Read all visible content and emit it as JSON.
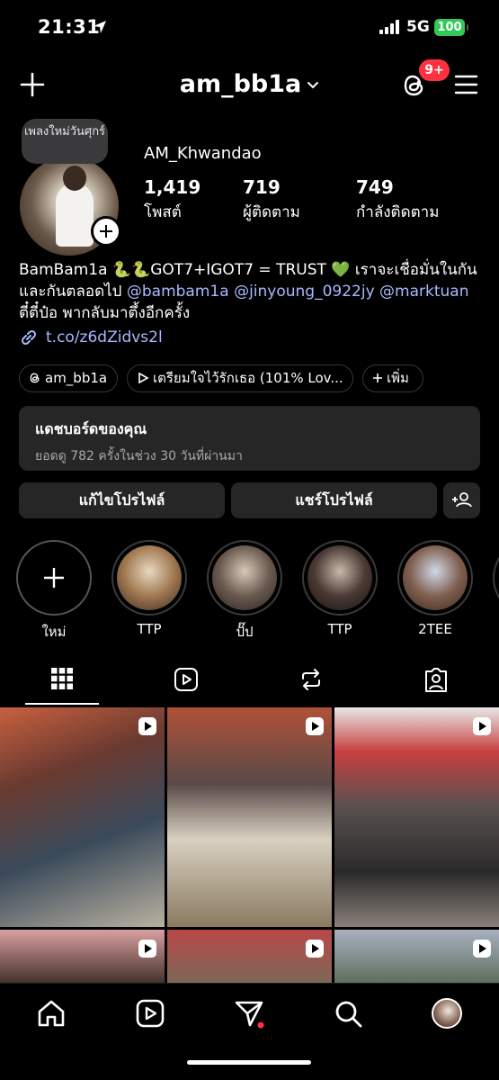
{
  "status_bar": {
    "time": "21:31",
    "network": "5G",
    "battery": "100"
  },
  "header": {
    "username": "am_bb1a",
    "notification_count": "9+"
  },
  "profile": {
    "note": "เพลงใหม่วันศุกร์",
    "display_name": "AM_Khwandao",
    "stats": [
      {
        "num": "1,419",
        "label": "โพสต์"
      },
      {
        "num": "719",
        "label": "ผู้ติดตาม"
      },
      {
        "num": "749",
        "label": "กำลังติดตาม"
      }
    ]
  },
  "bio": {
    "line1": "BamBam1a 🐍🐍GOT7+IGOT7 = TRUST 💚 เราจะเชื่อมั่นในกัน",
    "line2_text": "และกันตลอดไป ",
    "mentions": [
      "@bambam1a",
      "@jinyoung_0922jy",
      "@marktuan"
    ],
    "line3": "ตี๋ตี๋ป๋อ พากลับมาตึ้งอีกครั้ง",
    "link": "t.co/z6dZidvs2l"
  },
  "chips": [
    {
      "label": "am_bb1a"
    },
    {
      "label": "เตรียมใจไว้รักเธอ (101% Lov..."
    },
    {
      "label": "เพิ่ม"
    }
  ],
  "dashboard": {
    "title": "แดชบอร์ดของคุณ",
    "subtitle": "ยอดดู 782 ครั้งในช่วง 30 วันที่ผ่านมา"
  },
  "buttons": {
    "edit_profile": "แก้ไขโปรไฟล์",
    "share_profile": "แชร์โปรไฟล์"
  },
  "highlights": [
    {
      "label": "ใหม่"
    },
    {
      "label": "TTP"
    },
    {
      "label": "ปั๊ป"
    },
    {
      "label": "TTP"
    },
    {
      "label": "2TEE"
    }
  ],
  "colors": {
    "accent_link": "#a8b9ff",
    "badge": "#ff3040",
    "battery": "#34c759",
    "card": "#262626"
  }
}
